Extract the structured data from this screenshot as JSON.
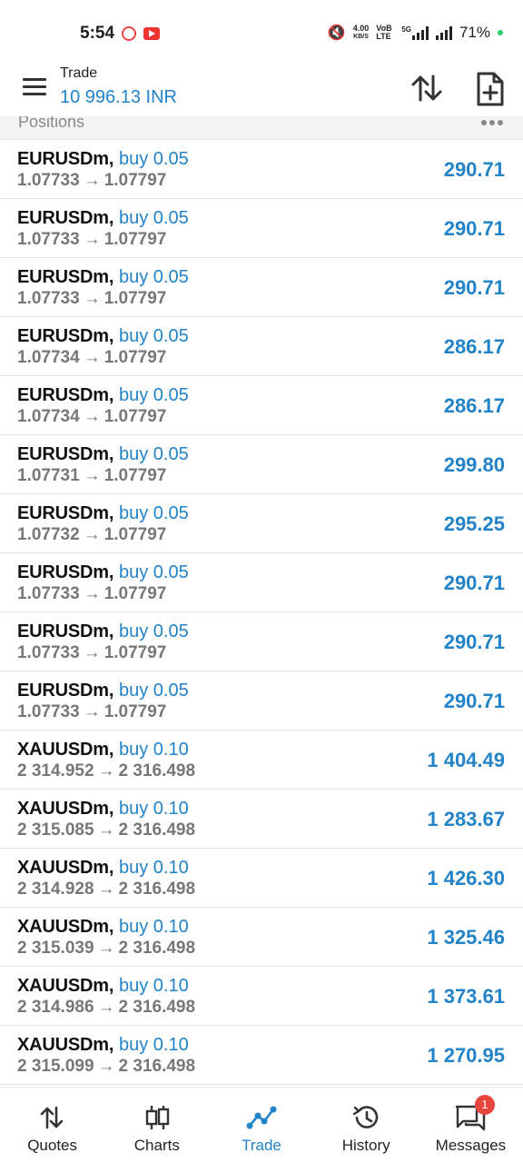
{
  "status_bar": {
    "time": "5:54",
    "net_speed_value": "4.00",
    "net_speed_unit": "KB/S",
    "volte": "VoB LTE",
    "network": "5G",
    "battery": "71%"
  },
  "header": {
    "title": "Trade",
    "balance": "10 996.13 INR"
  },
  "section": {
    "title": "Positions"
  },
  "positions": [
    {
      "symbol": "EURUSDm",
      "side": "buy 0.05",
      "open": "1.07733",
      "current": "1.07797",
      "profit": "290.71"
    },
    {
      "symbol": "EURUSDm",
      "side": "buy 0.05",
      "open": "1.07733",
      "current": "1.07797",
      "profit": "290.71"
    },
    {
      "symbol": "EURUSDm",
      "side": "buy 0.05",
      "open": "1.07733",
      "current": "1.07797",
      "profit": "290.71"
    },
    {
      "symbol": "EURUSDm",
      "side": "buy 0.05",
      "open": "1.07734",
      "current": "1.07797",
      "profit": "286.17"
    },
    {
      "symbol": "EURUSDm",
      "side": "buy 0.05",
      "open": "1.07734",
      "current": "1.07797",
      "profit": "286.17"
    },
    {
      "symbol": "EURUSDm",
      "side": "buy 0.05",
      "open": "1.07731",
      "current": "1.07797",
      "profit": "299.80"
    },
    {
      "symbol": "EURUSDm",
      "side": "buy 0.05",
      "open": "1.07732",
      "current": "1.07797",
      "profit": "295.25"
    },
    {
      "symbol": "EURUSDm",
      "side": "buy 0.05",
      "open": "1.07733",
      "current": "1.07797",
      "profit": "290.71"
    },
    {
      "symbol": "EURUSDm",
      "side": "buy 0.05",
      "open": "1.07733",
      "current": "1.07797",
      "profit": "290.71"
    },
    {
      "symbol": "EURUSDm",
      "side": "buy 0.05",
      "open": "1.07733",
      "current": "1.07797",
      "profit": "290.71"
    },
    {
      "symbol": "XAUUSDm",
      "side": "buy 0.10",
      "open": "2 314.952",
      "current": "2 316.498",
      "profit": "1 404.49"
    },
    {
      "symbol": "XAUUSDm",
      "side": "buy 0.10",
      "open": "2 315.085",
      "current": "2 316.498",
      "profit": "1 283.67"
    },
    {
      "symbol": "XAUUSDm",
      "side": "buy 0.10",
      "open": "2 314.928",
      "current": "2 316.498",
      "profit": "1 426.30"
    },
    {
      "symbol": "XAUUSDm",
      "side": "buy 0.10",
      "open": "2 315.039",
      "current": "2 316.498",
      "profit": "1 325.46"
    },
    {
      "symbol": "XAUUSDm",
      "side": "buy 0.10",
      "open": "2 314.986",
      "current": "2 316.498",
      "profit": "1 373.61"
    },
    {
      "symbol": "XAUUSDm",
      "side": "buy 0.10",
      "open": "2 315.099",
      "current": "2 316.498",
      "profit": "1 270.95"
    }
  ],
  "arrow_glyph": "→",
  "bottom_nav": [
    {
      "label": "Quotes",
      "icon": "quotes-arrows-icon"
    },
    {
      "label": "Charts",
      "icon": "candlestick-icon"
    },
    {
      "label": "Trade",
      "icon": "trade-line-icon",
      "active": true
    },
    {
      "label": "History",
      "icon": "history-clock-icon"
    },
    {
      "label": "Messages",
      "icon": "messages-chat-icon",
      "badge": "1"
    }
  ],
  "colors": {
    "accent": "#2283c8",
    "badge": "#e8453c",
    "secondary_text": "#777777"
  }
}
